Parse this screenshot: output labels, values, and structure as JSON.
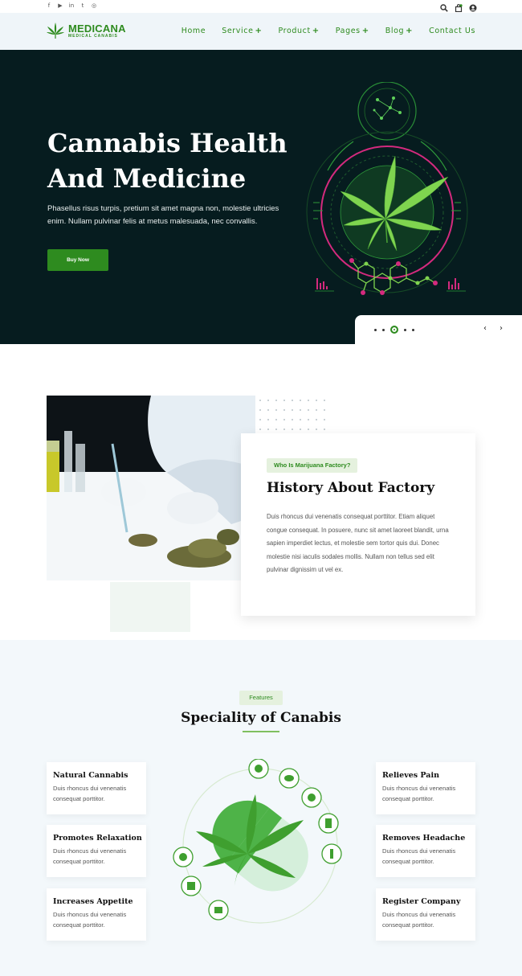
{
  "topbar": {
    "social": [
      {
        "icon": "facebook-icon",
        "glyph": "f"
      },
      {
        "icon": "youtube-icon",
        "glyph": "▶"
      },
      {
        "icon": "linkedin-icon",
        "glyph": "in"
      },
      {
        "icon": "twitter-icon",
        "glyph": "t"
      },
      {
        "icon": "instagram-icon",
        "glyph": "◎"
      }
    ],
    "icons": [
      "search-icon",
      "cart-icon",
      "user-icon"
    ]
  },
  "header": {
    "logo_name": "MEDICANA",
    "logo_sub": "MEDICAL CANABIS",
    "nav": [
      {
        "label": "Home",
        "plus": ""
      },
      {
        "label": "Service",
        "plus": "+"
      },
      {
        "label": "Product",
        "plus": "+"
      },
      {
        "label": "Pages",
        "plus": "+"
      },
      {
        "label": "Blog",
        "plus": "+"
      },
      {
        "label": "Contact Us",
        "plus": ""
      }
    ]
  },
  "hero": {
    "title_line1": "Cannabis Health",
    "title_line2": "And Medicine",
    "text": "Phasellus risus turpis, pretium sit amet magna non, molestie ultricies enim. Nullam pulvinar felis at metus malesuada, nec convallis.",
    "button": "Buy Now",
    "prev_arrow": "‹",
    "next_arrow": "›"
  },
  "about": {
    "tag": "Who Is Marijuana Factory?",
    "heading": "History About Factory",
    "text": "Duis rhoncus dui venenatis consequat porttitor. Etiam aliquet congue consequat. In posuere, nunc sit amet laoreet blandit, urna sapien imperdiet lectus, et molestie sem tortor quis dui. Donec molestie nisi iaculis sodales mollis. Nullam non tellus sed elit pulvinar dignissim ut vel ex."
  },
  "features": {
    "tag": "Features",
    "title": "Speciality of Canabis",
    "left": [
      {
        "title": "Natural Cannabis",
        "text": "Duis rhoncus dui venenatis consequat porttitor."
      },
      {
        "title": "Promotes Relaxation",
        "text": "Duis rhoncus dui venenatis consequat porttitor."
      },
      {
        "title": "Increases Appetite",
        "text": "Duis rhoncus dui venenatis consequat porttitor."
      }
    ],
    "right": [
      {
        "title": "Relieves Pain",
        "text": "Duis rhoncus dui venenatis consequat porttitor."
      },
      {
        "title": "Removes Headache",
        "text": "Duis rhoncus dui venenatis consequat porttitor."
      },
      {
        "title": "Register Company",
        "text": "Duis rhoncus dui venenatis consequat porttitor."
      }
    ]
  },
  "colors": {
    "brand_green": "#2e8b1f",
    "hero_bg": "#061c1f",
    "accent_pink": "#d42a7e",
    "light_green": "#e5f1de",
    "section_bg": "#f3f8fb"
  }
}
